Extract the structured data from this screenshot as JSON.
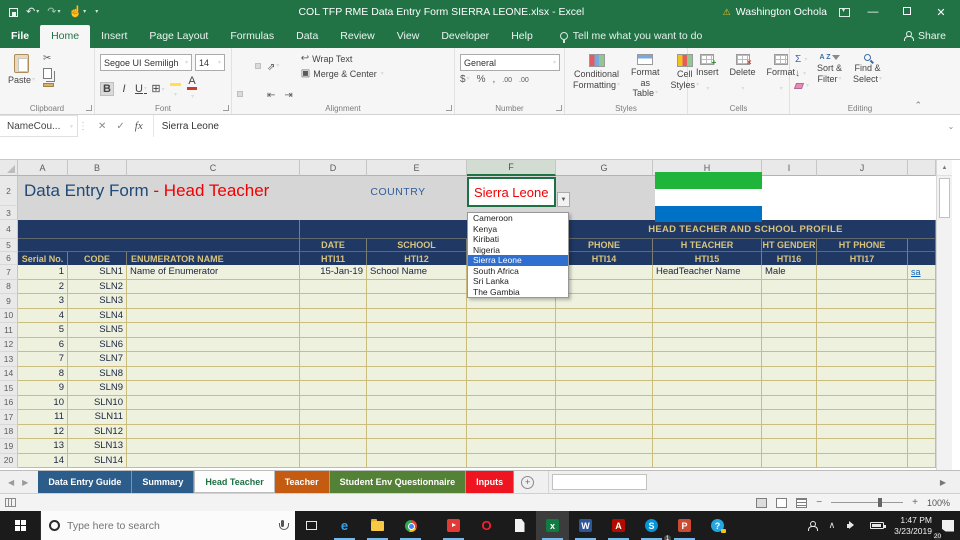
{
  "colors": {
    "excel_green": "#217346",
    "band_blue": "#1F3864",
    "header_gold": "#D9C47E",
    "row_fill": "#EDF1DD",
    "title_blue": "#1F4978",
    "accent_red": "#F00000",
    "flag_green": "#1EB53A",
    "flag_blue": "#0072C6",
    "highlight_blue": "#2F6FD0",
    "link_blue": "#0B62C4"
  },
  "titlebar": {
    "title": "COL TFP RME Data Entry Form SIERRA LEONE.xlsx  -  Excel",
    "user": "Washington Ochola"
  },
  "ribbon": {
    "tabs": [
      {
        "label": "File",
        "cls": "file"
      },
      {
        "label": "Home",
        "cls": "active"
      },
      {
        "label": "Insert"
      },
      {
        "label": "Page Layout"
      },
      {
        "label": "Formulas"
      },
      {
        "label": "Data"
      },
      {
        "label": "Review"
      },
      {
        "label": "View"
      },
      {
        "label": "Developer"
      },
      {
        "label": "Help"
      }
    ],
    "tell_me": "Tell me what you want to do",
    "share": "Share",
    "clipboard": {
      "label": "Clipboard",
      "paste": "Paste"
    },
    "font": {
      "label": "Font",
      "name": "Segoe UI Semiligh",
      "size": "14",
      "bold": "B",
      "italic": "I",
      "underline": "U",
      "grow": "A",
      "shrink": "A",
      "color_a": "A"
    },
    "alignment": {
      "label": "Alignment",
      "wrap": "Wrap Text",
      "merge": "Merge & Center"
    },
    "number": {
      "label": "Number",
      "format": "General",
      "currency": "$",
      "percent": "%",
      "comma": ",",
      "inc_dec": ".00",
      "dec_dec": ".00"
    },
    "styles": {
      "label": "Styles",
      "cond1": "Conditional",
      "cond2": "Formatting",
      "fmt1": "Format as",
      "fmt2": "Table",
      "cs1": "Cell",
      "cs2": "Styles"
    },
    "cells": {
      "label": "Cells",
      "insert": "Insert",
      "delete": "Delete",
      "format": "Format"
    },
    "editing": {
      "label": "Editing",
      "sum": "Σ",
      "az": "A Z",
      "sf1": "Sort &",
      "sf2": "Filter",
      "fs1": "Find &",
      "fs2": "Select"
    }
  },
  "formula_bar": {
    "name_box": "NameCou...",
    "fx": "fx",
    "value": "Sierra Leone",
    "cancel": "✕",
    "enter": "✓"
  },
  "sheet": {
    "columns": [
      "A",
      "B",
      "C",
      "D",
      "E",
      "F",
      "G",
      "H",
      "I",
      "J"
    ],
    "gutter": [
      "2",
      "3",
      "4",
      "5",
      "6"
    ],
    "form": {
      "title_main": "Data Entry Form ",
      "title_accent": "- Head Teacher",
      "country_label": "COUNTRY",
      "country_value": "Sierra Leone"
    },
    "dropdown": {
      "items": [
        {
          "label": "Cameroon"
        },
        {
          "label": "Kenya"
        },
        {
          "label": "Kiribati"
        },
        {
          "label": "Nigeria"
        },
        {
          "label": "Sierra Leone",
          "cls": "sel"
        },
        {
          "label": "South Africa"
        },
        {
          "label": "Sri Lanka"
        },
        {
          "label": "The Gambia"
        }
      ],
      "selected": "Sierra Leone"
    },
    "table": {
      "section_header": "HEAD TEACHER AND SCHOOL PROFILE",
      "row5": {
        "date": "DATE",
        "school": "SCHOOL",
        "phone": "PHONE",
        "h_teacher": "H TEACHER",
        "ht_gender": "HT GENDER",
        "ht_phone": "HT PHONE"
      },
      "row6": {
        "serial": "Serial No.",
        "code": "CODE",
        "enumerator": "ENUMERATOR NAME",
        "hti11": "HTI11",
        "hti12": "HTI12",
        "hti14": "HTI14",
        "hti15": "HTI15",
        "hti16": "HTI16",
        "hti17": "HTI17"
      }
    },
    "rows": [
      {
        "n": "7",
        "serial": "1",
        "code": "SLN1",
        "name": "Name of Enumerator",
        "date": "15-Jan-19",
        "school": "School Name",
        "teacher": "HeadTeacher Name",
        "gender": "Male",
        "link": "sa"
      },
      {
        "n": "8",
        "serial": "2",
        "code": "SLN2"
      },
      {
        "n": "9",
        "serial": "3",
        "code": "SLN3"
      },
      {
        "n": "10",
        "serial": "4",
        "code": "SLN4"
      },
      {
        "n": "11",
        "serial": "5",
        "code": "SLN5"
      },
      {
        "n": "12",
        "serial": "6",
        "code": "SLN6"
      },
      {
        "n": "13",
        "serial": "7",
        "code": "SLN7"
      },
      {
        "n": "14",
        "serial": "8",
        "code": "SLN8"
      },
      {
        "n": "15",
        "serial": "9",
        "code": "SLN9"
      },
      {
        "n": "16",
        "serial": "10",
        "code": "SLN10"
      },
      {
        "n": "17",
        "serial": "11",
        "code": "SLN11"
      },
      {
        "n": "18",
        "serial": "12",
        "code": "SLN12"
      },
      {
        "n": "19",
        "serial": "13",
        "code": "SLN13"
      },
      {
        "n": "20",
        "serial": "14",
        "code": "SLN14"
      }
    ]
  },
  "sheet_tabs": [
    {
      "label": "Data Entry Guide",
      "bg": "#2c5d8a",
      "fg": "#ffffff"
    },
    {
      "label": "Summary",
      "bg": "#2c5d8a",
      "fg": "#ffffff"
    },
    {
      "label": "Head Teacher",
      "cls": "active",
      "fg": "#1e7145"
    },
    {
      "label": "Teacher",
      "bg": "#c55a11",
      "fg": "#ffffff"
    },
    {
      "label": "Student Env Questionnaire",
      "bg": "#538135",
      "fg": "#ffffff"
    },
    {
      "label": "Inputs",
      "bg": "#ee1520",
      "fg": "#ffffff"
    }
  ],
  "status_bar": {
    "zoom": "100%"
  },
  "taskbar": {
    "search_placeholder": "Type here to search",
    "icons": {
      "edge": "e",
      "opera": "O",
      "excel": "x",
      "word": "W",
      "acrobat": "A",
      "skype": "S",
      "powerpoint": "P",
      "help": "?"
    },
    "skype_badge": "1",
    "time": "1:47 PM",
    "date": "3/23/2019",
    "notif_badge": "20"
  }
}
